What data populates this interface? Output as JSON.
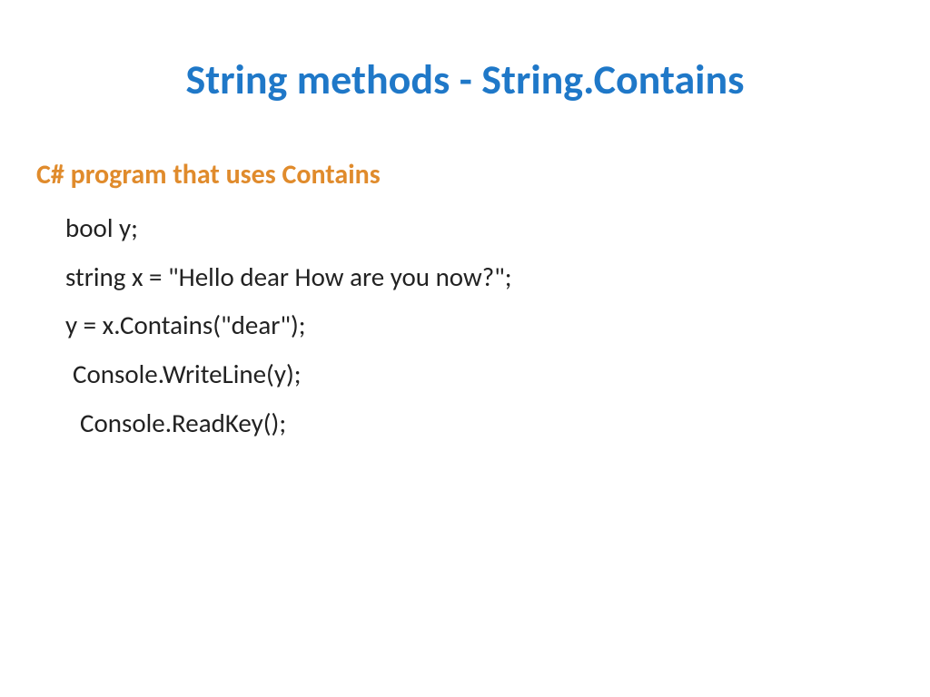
{
  "slide": {
    "title": "String methods - String.Contains",
    "subheading": "C# program that uses Contains",
    "code": {
      "line1": "bool y;",
      "line2": "string x = \"Hello dear How are you now?\";",
      "line3": "y = x.Contains(\"dear\");",
      "line4": "Console.WriteLine(y);",
      "line5": "Console.ReadKey();"
    }
  }
}
